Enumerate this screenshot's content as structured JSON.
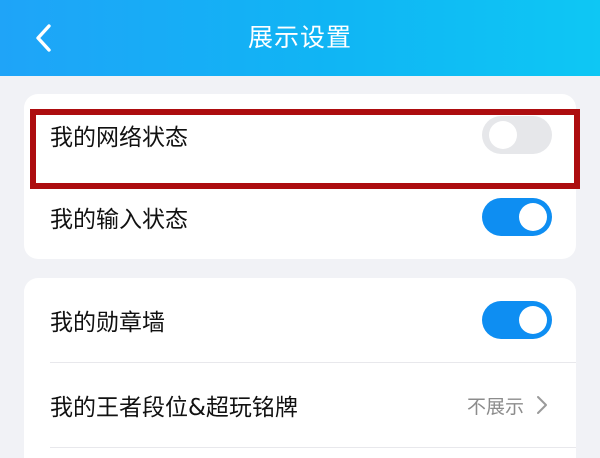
{
  "header": {
    "title": "展示设置"
  },
  "section1": {
    "items": [
      {
        "label": "我的网络状态",
        "toggle": "off"
      },
      {
        "label": "我的输入状态",
        "toggle": "on"
      }
    ]
  },
  "section2": {
    "items": [
      {
        "label": "我的勋章墙",
        "toggle": "on"
      },
      {
        "label": "我的王者段位&超玩铭牌",
        "value": "不展示"
      }
    ]
  },
  "colors": {
    "header_start": "#1fa4f8",
    "header_end": "#0ec7f4",
    "toggle_on": "#0e8ef2",
    "toggle_off": "#e6e7ea",
    "highlight": "#ad0d0f"
  }
}
